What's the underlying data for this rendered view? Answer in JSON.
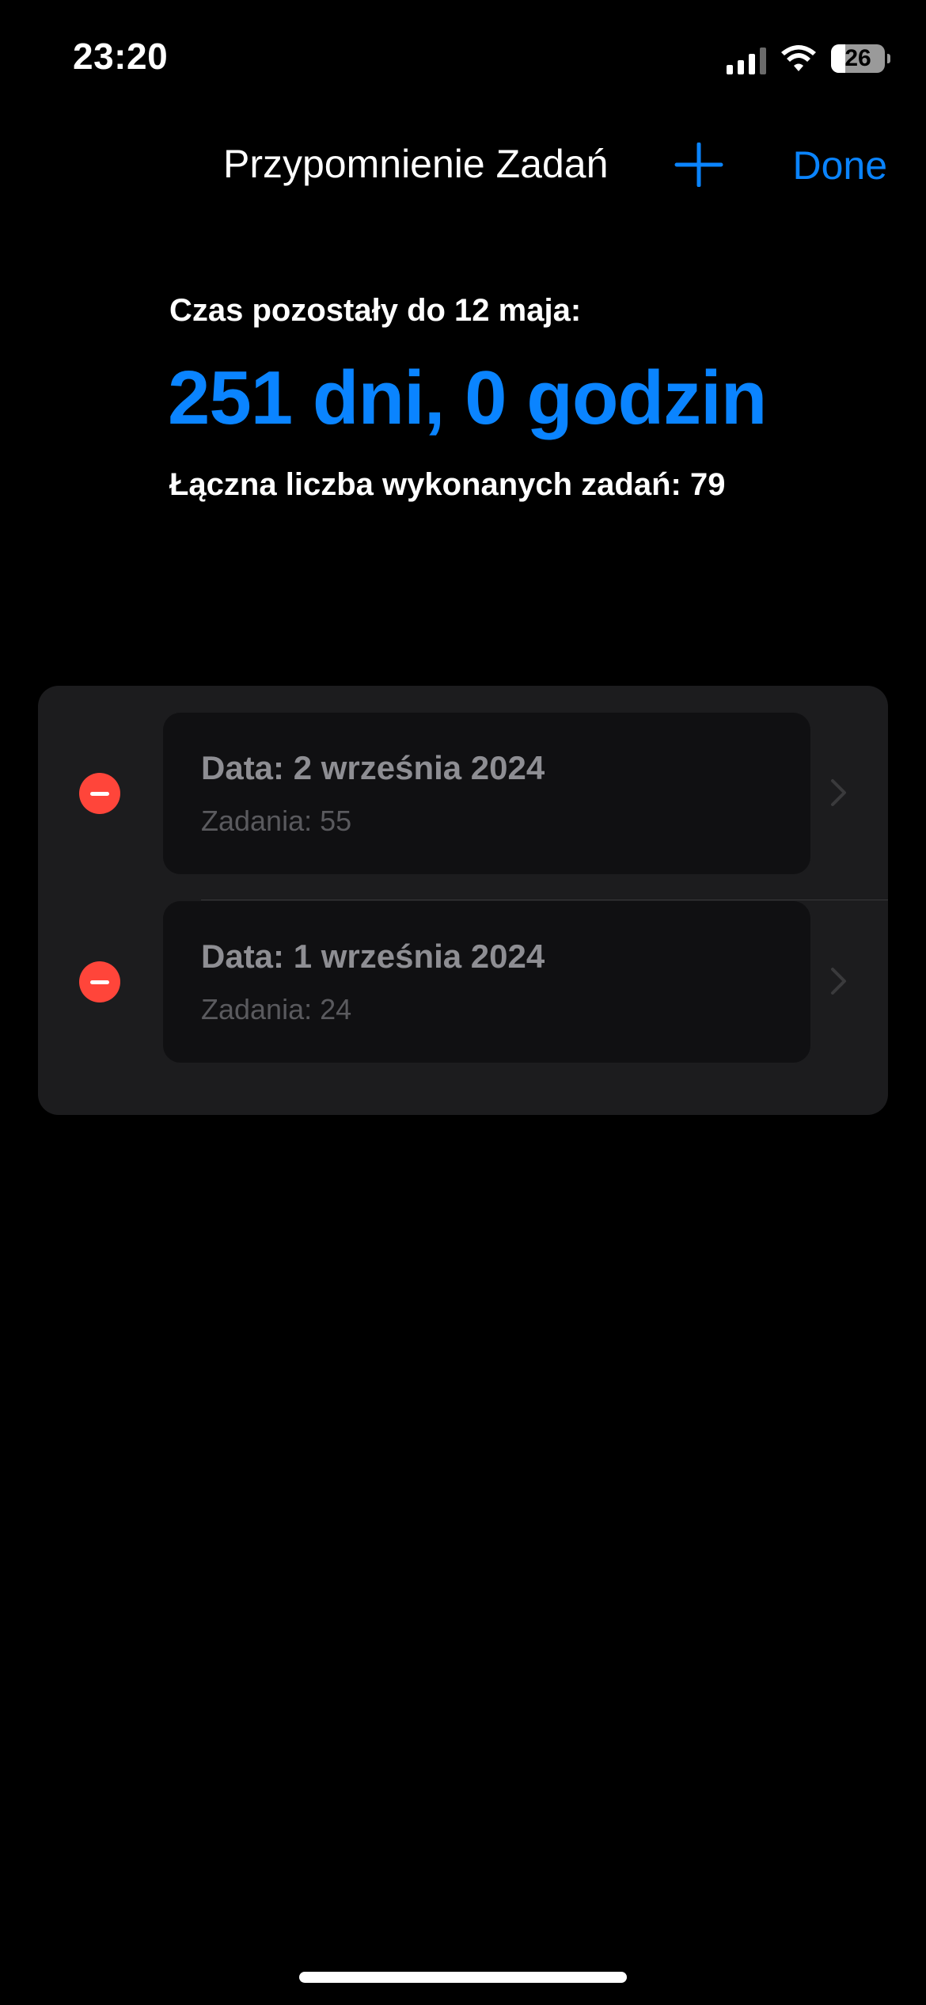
{
  "status_bar": {
    "time": "23:20",
    "battery_level": "26",
    "battery_fraction": 0.26,
    "icons": [
      "signal-icon",
      "wifi-icon",
      "battery-icon"
    ]
  },
  "nav": {
    "title": "Przypomnienie Zadań",
    "add_icon": "plus-icon",
    "done_label": "Done"
  },
  "summary": {
    "countdown_label": "Czas pozostały do 12 maja:",
    "countdown_value": "251 dni, 0 godzin",
    "total_label": "Łączna liczba wykonanych zadań: 79"
  },
  "entries": [
    {
      "date": "Data: 2 września 2024",
      "tasks": "Zadania: 55"
    },
    {
      "date": "Data: 1 września 2024",
      "tasks": "Zadania: 24"
    }
  ],
  "colors": {
    "accent": "#0a84ff",
    "delete": "#ff453a",
    "background": "#000000",
    "card": "#1c1c1e"
  }
}
